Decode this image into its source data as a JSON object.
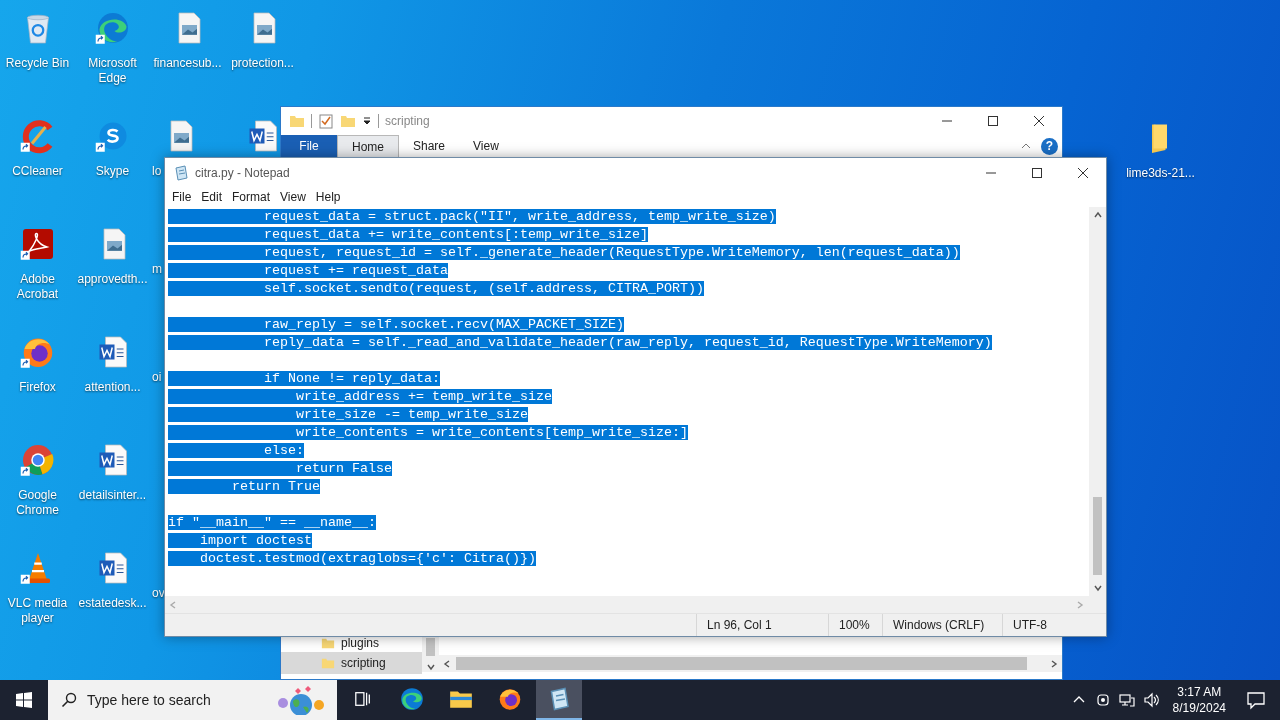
{
  "desktop_rows": [
    [
      {
        "label": "Recycle Bin",
        "kind": "recycle",
        "clipped": false
      },
      {
        "label": "Microsoft Edge",
        "kind": "edge",
        "clipped": false
      },
      {
        "label": "financesub...",
        "kind": "picture-file",
        "clipped": false
      },
      {
        "label": "protection...",
        "kind": "picture-file",
        "clipped": false
      }
    ],
    [
      {
        "label": "CCleaner",
        "kind": "ccleaner",
        "clipped": false
      },
      {
        "label": "Skype",
        "kind": "skype",
        "clipped": false
      },
      {
        "label": "lo",
        "kind": "picture-file",
        "clipped": true
      },
      {
        "kind": "word-file",
        "clipped": false
      }
    ],
    [
      {
        "label": "Adobe Acrobat",
        "kind": "acrobat",
        "clipped": false
      },
      {
        "label": "approvedth...",
        "kind": "picture-file",
        "clipped": false
      },
      {
        "label": "m",
        "kind": "none",
        "clipped": true
      }
    ],
    [
      {
        "label": "Firefox",
        "kind": "firefox",
        "clipped": false
      },
      {
        "label": "attention...",
        "kind": "word-file",
        "clipped": false
      },
      {
        "label": "oi",
        "kind": "none",
        "clipped": true
      }
    ],
    [
      {
        "label": "Google Chrome",
        "kind": "chrome",
        "clipped": false
      },
      {
        "label": "detailsinter...",
        "kind": "word-file",
        "clipped": false
      }
    ],
    [
      {
        "label": "VLC media player",
        "kind": "vlc",
        "clipped": false
      },
      {
        "label": "estatedesk...",
        "kind": "word-file",
        "clipped": false
      },
      {
        "label": "ov",
        "kind": "none",
        "clipped": true
      }
    ]
  ],
  "desktop_right_icon": {
    "label": "lime3ds-21...",
    "kind": "folder"
  },
  "explorer": {
    "title": "scripting",
    "help": "?",
    "ribbon_tabs": [
      {
        "label": "File",
        "kind": "menu"
      },
      {
        "label": "Home",
        "kind": "tab",
        "selected": true
      },
      {
        "label": "Share",
        "kind": "tab",
        "selected": false
      },
      {
        "label": "View",
        "kind": "tab",
        "selected": false
      }
    ],
    "nav_items": [
      {
        "label": "plugins",
        "selected": false
      },
      {
        "label": "scripting",
        "selected": true
      }
    ]
  },
  "notepad": {
    "title": "citra.py - Notepad",
    "menu": [
      "File",
      "Edit",
      "Format",
      "View",
      "Help"
    ],
    "lines": [
      {
        "kind": "code",
        "text": "            request_data = struct.pack(\"II\", write_address, temp_write_size)",
        "selected": true
      },
      {
        "kind": "code",
        "text": "            request_data += write_contents[:temp_write_size]",
        "selected": true
      },
      {
        "kind": "code",
        "text": "            request, request_id = self._generate_header(RequestType.WriteMemory, len(request_data))",
        "selected": true
      },
      {
        "kind": "code",
        "text": "            request += request_data",
        "selected": true
      },
      {
        "kind": "code",
        "text": "            self.socket.sendto(request, (self.address, CITRA_PORT))",
        "selected": true
      },
      {
        "kind": "blank"
      },
      {
        "kind": "code",
        "text": "            raw_reply = self.socket.recv(MAX_PACKET_SIZE)",
        "selected": true
      },
      {
        "kind": "code",
        "text": "            reply_data = self._read_and_validate_header(raw_reply, request_id, RequestType.WriteMemory)",
        "selected": true
      },
      {
        "kind": "blank"
      },
      {
        "kind": "code",
        "text": "            if None != reply_data:",
        "selected": true
      },
      {
        "kind": "code",
        "text": "                write_address += temp_write_size",
        "selected": true
      },
      {
        "kind": "code",
        "text": "                write_size -= temp_write_size",
        "selected": true
      },
      {
        "kind": "code",
        "text": "                write_contents = write_contents[temp_write_size:]",
        "selected": true
      },
      {
        "kind": "code",
        "text": "            else:",
        "selected": true
      },
      {
        "kind": "code",
        "text": "                return False",
        "selected": true
      },
      {
        "kind": "code",
        "text": "        return True",
        "selected": true
      },
      {
        "kind": "blank"
      },
      {
        "kind": "code",
        "text": "if \"__main__\" == __name__:",
        "selected": true
      },
      {
        "kind": "code",
        "text": "    import doctest",
        "selected": true
      },
      {
        "kind": "code",
        "text": "    doctest.testmod(extraglobs={'c': Citra()})",
        "selected": true
      }
    ],
    "status": {
      "position": "Ln 96, Col 1",
      "zoom": "100%",
      "line_endings": "Windows (CRLF)",
      "encoding": "UTF-8"
    }
  },
  "taskbar": {
    "search_placeholder": "Type here to search",
    "apps": [
      {
        "kind": "task-view",
        "selected": false
      },
      {
        "kind": "edge",
        "selected": false
      },
      {
        "kind": "explorer",
        "selected": false
      },
      {
        "kind": "firefox",
        "selected": false
      },
      {
        "kind": "notepad",
        "selected": true
      }
    ],
    "time": "3:17 AM",
    "date": "8/19/2024"
  }
}
